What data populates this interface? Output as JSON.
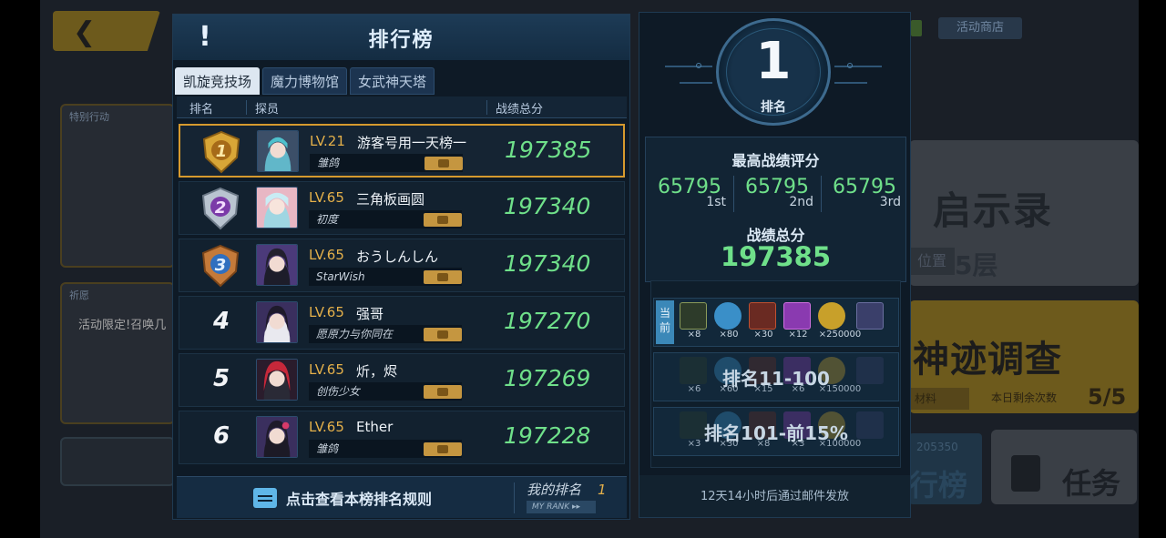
{
  "background": {
    "shop_label": "活动商店",
    "left_card1_tag": "特别行动",
    "left_card2_tag": "祈愿",
    "left_card2_promo": "活动限定!召唤几",
    "right_card1_title": "启示录",
    "right_card1_loc": "位置",
    "right_card1_floor": "5层",
    "right_card2_title": "神迹调查",
    "right_card2_tag": "材料",
    "right_card2_count_label": "本日剩余次数",
    "right_card2_count": "5/5",
    "rank_btn_num": "205350",
    "rank_btn_label": "行榜",
    "task_label": "任务"
  },
  "panel": {
    "title": "排行榜",
    "alert_icon": "!",
    "tabs": [
      {
        "label": "凯旋竞技场",
        "active": true
      },
      {
        "label": "魔力博物馆",
        "active": false
      },
      {
        "label": "女武神天塔",
        "active": false
      }
    ],
    "columns": {
      "rank": "排名",
      "member": "探员",
      "score": "战绩总分"
    },
    "rows": [
      {
        "rank": "1",
        "level": "LV.21",
        "name": "游客号用一天榜一",
        "guild": "雏鸽",
        "score": "197385",
        "medal_color": "#d8a637"
      },
      {
        "rank": "2",
        "level": "LV.65",
        "name": "三角板画圆",
        "guild": "初度",
        "score": "197340",
        "medal_color": "#b9c4d0"
      },
      {
        "rank": "3",
        "level": "LV.65",
        "name": "おうしんしん",
        "guild": "StarWish",
        "score": "197340",
        "medal_color": "#c47a3a"
      },
      {
        "rank": "4",
        "level": "LV.65",
        "name": "强哥",
        "guild": "愿原力与你同在",
        "score": "197270"
      },
      {
        "rank": "5",
        "level": "LV.65",
        "name": "炘，烬",
        "guild": "创伤少女",
        "score": "197269"
      },
      {
        "rank": "6",
        "level": "LV.65",
        "name": "Ether",
        "guild": "雏鸽",
        "score": "197228"
      }
    ],
    "footer": {
      "rules_label": "点击查看本榜排名规则",
      "my_rank_label": "我的排名",
      "my_rank_value": "1",
      "my_rank_en": "MY RANK ▸▸"
    }
  },
  "info": {
    "rank_number": "1",
    "rank_label": "排名",
    "best_label": "最高战绩评分",
    "best": [
      {
        "value": "65795",
        "ord": "1st"
      },
      {
        "value": "65795",
        "ord": "2nd"
      },
      {
        "value": "65795",
        "ord": "3rd"
      }
    ],
    "total_label": "战绩总分",
    "total_value": "197385",
    "current_tag": "当前",
    "reward_tiers": [
      {
        "label": "",
        "counts": [
          "×8",
          "×80",
          "×30",
          "×12",
          "×250000",
          ""
        ]
      },
      {
        "label": "排名11-100",
        "counts": [
          "×6",
          "×60",
          "×15",
          "×6",
          "×150000",
          ""
        ]
      },
      {
        "label": "排名101-前15%",
        "counts": [
          "×3",
          "×30",
          "×8",
          "×3",
          "×100000",
          ""
        ]
      }
    ],
    "mail_note": "12天14小时后通过邮件发放"
  }
}
